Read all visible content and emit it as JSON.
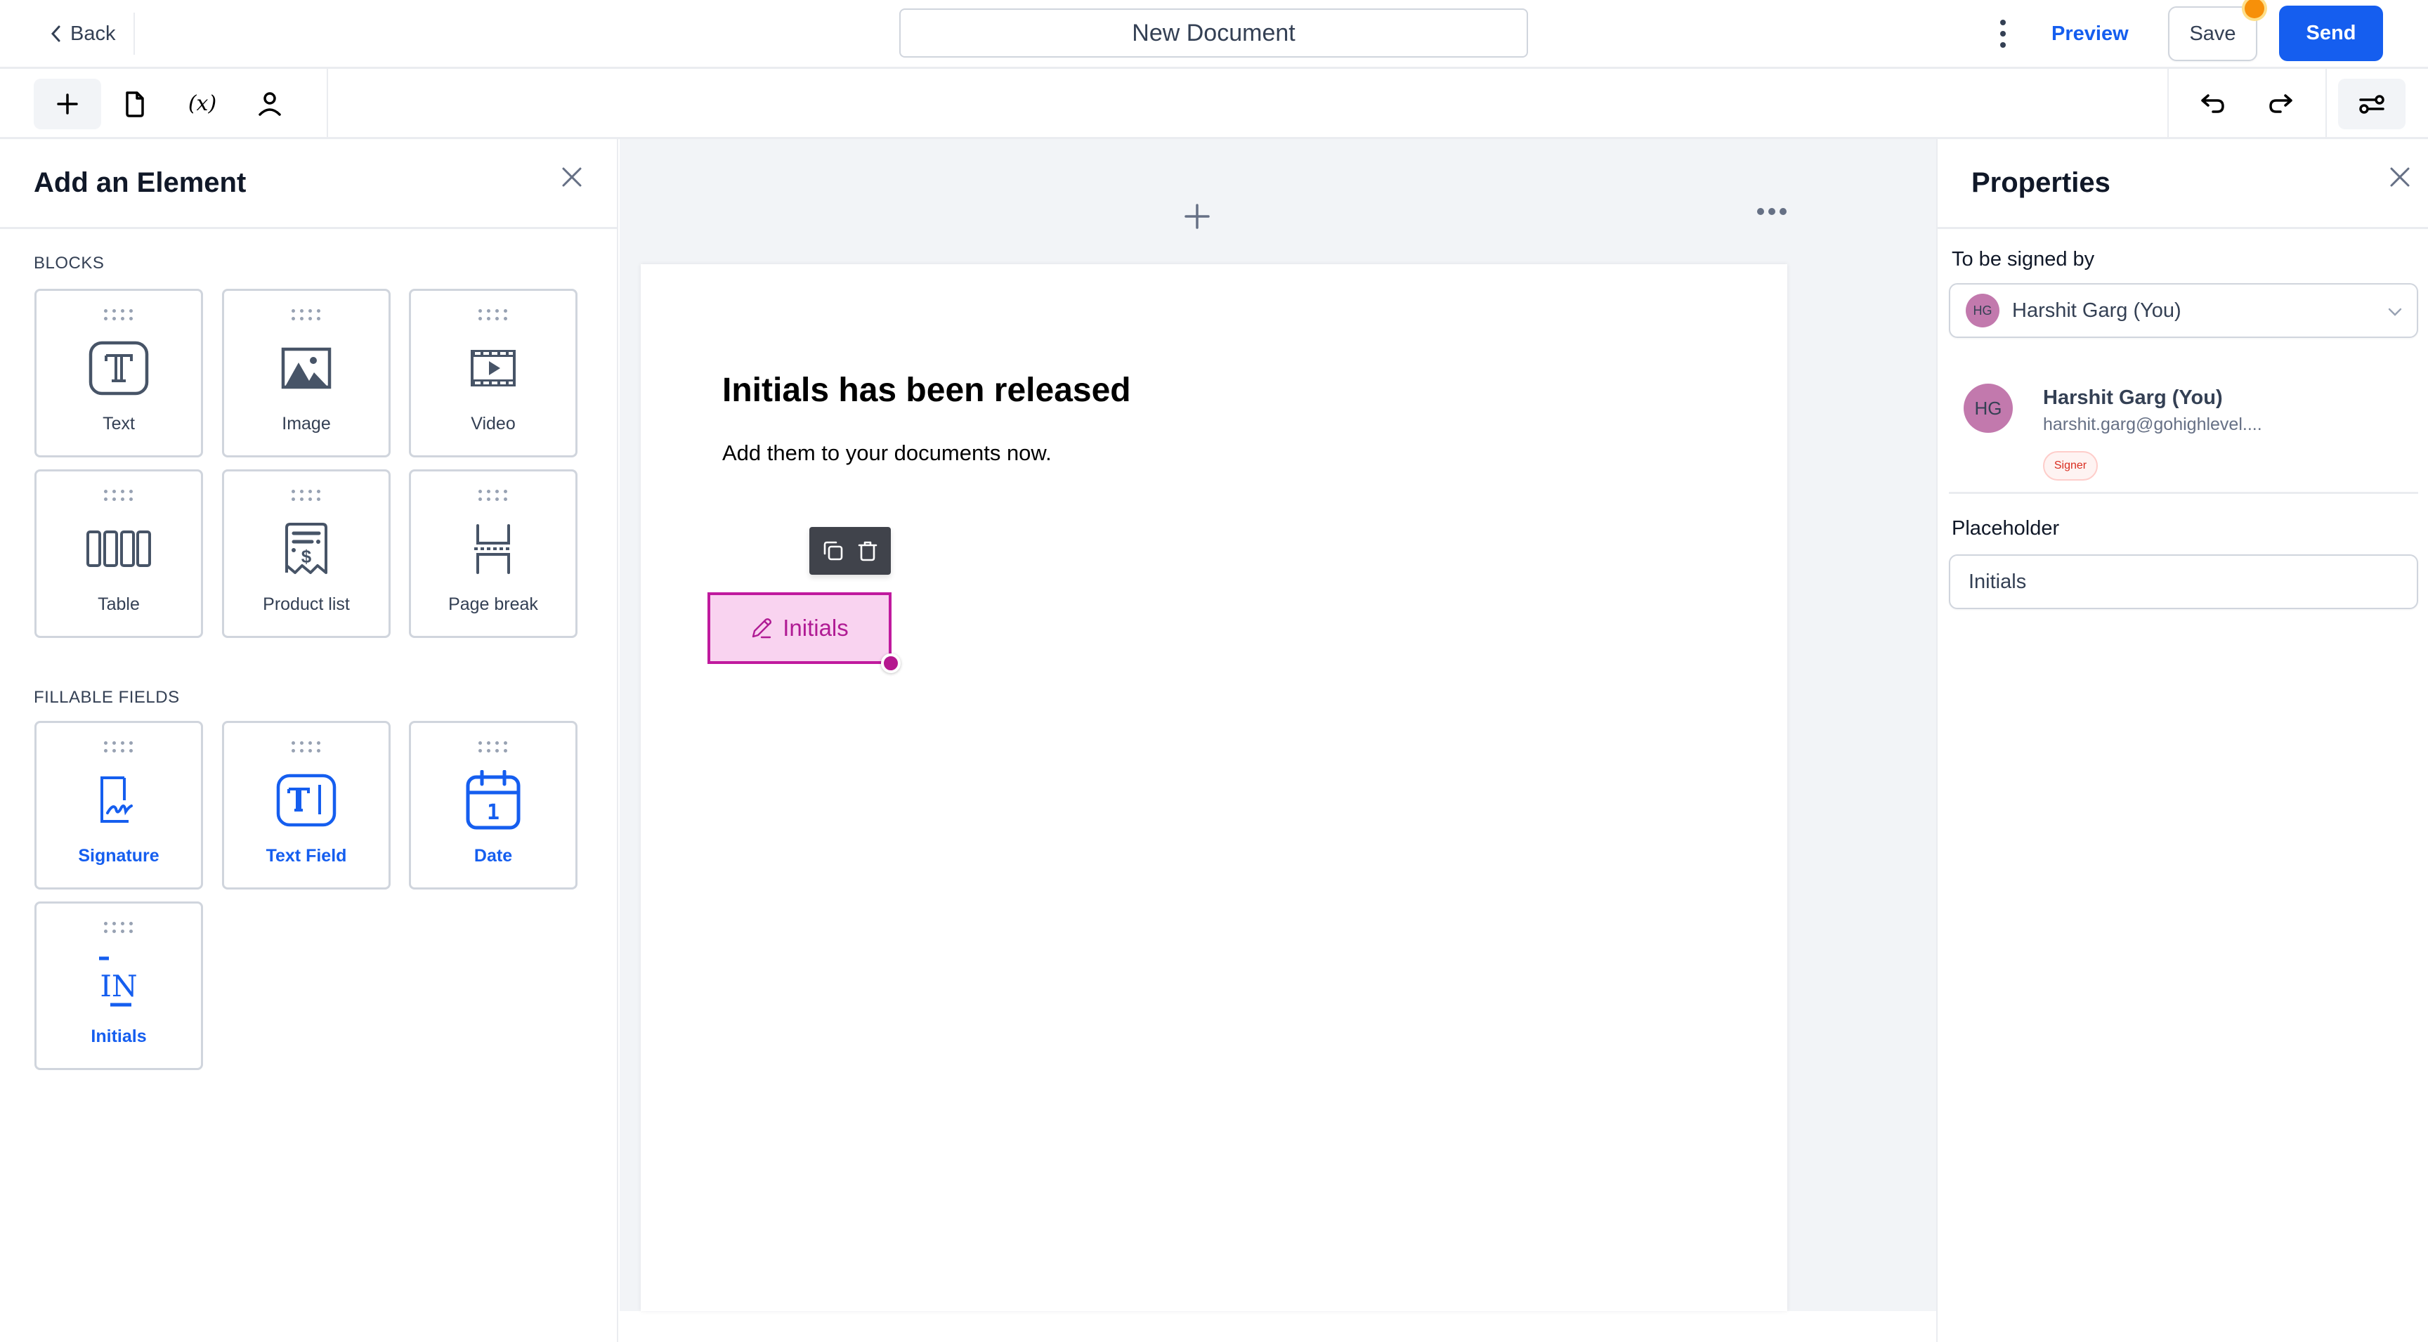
{
  "header": {
    "back_label": "Back",
    "document_title": "New Document",
    "more_icon": "kebab-vertical-icon",
    "preview_label": "Preview",
    "save_label": "Save",
    "send_label": "Send",
    "unsaved_indicator_color": "#F79009",
    "accent_color": "#155EEF"
  },
  "toolbar": {
    "left_tools": [
      {
        "name": "add-element",
        "icon": "plus-icon",
        "active": true
      },
      {
        "name": "pages",
        "icon": "file-icon",
        "active": false
      },
      {
        "name": "variables",
        "icon": "variable-icon",
        "label": "(x)",
        "active": false
      },
      {
        "name": "recipients",
        "icon": "user-icon",
        "active": false
      }
    ],
    "right_tools": [
      {
        "name": "undo",
        "icon": "undo-icon"
      },
      {
        "name": "redo",
        "icon": "redo-icon"
      },
      {
        "name": "settings",
        "icon": "sliders-icon",
        "active": true
      }
    ]
  },
  "left_panel": {
    "title": "Add an Element",
    "blocks_label": "BLOCKS",
    "blocks": [
      {
        "label": "Text",
        "icon": "text-icon"
      },
      {
        "label": "Image",
        "icon": "image-icon"
      },
      {
        "label": "Video",
        "icon": "video-icon"
      },
      {
        "label": "Table",
        "icon": "table-icon"
      },
      {
        "label": "Product list",
        "icon": "receipt-icon"
      },
      {
        "label": "Page break",
        "icon": "page-break-icon"
      }
    ],
    "fillable_label": "FILLABLE FIELDS",
    "fillable_fields": [
      {
        "label": "Signature",
        "icon": "signature-icon"
      },
      {
        "label": "Text Field",
        "icon": "text-field-icon"
      },
      {
        "label": "Date",
        "icon": "calendar-icon",
        "icon_text": "1"
      },
      {
        "label": "Initials",
        "icon": "initials-icon",
        "icon_text": "IN"
      }
    ]
  },
  "canvas": {
    "heading": "Initials has been released",
    "body": "Add them to your documents now.",
    "selected_field": {
      "label": "Initials",
      "icon": "pen-icon",
      "fill_color": "#F9D3F0",
      "border_color": "#C01A9E"
    },
    "field_actions": [
      "copy-icon",
      "trash-icon"
    ]
  },
  "right_panel": {
    "title": "Properties",
    "signed_by_label": "To be signed by",
    "signed_by_value": "Harshit Garg (You)",
    "signer": {
      "initials": "HG",
      "name": "Harshit Garg (You)",
      "email": "harshit.garg@gohighlevel....",
      "role": "Signer",
      "avatar_color": "#C279AD"
    },
    "placeholder_label": "Placeholder",
    "placeholder_value": "Initials"
  }
}
